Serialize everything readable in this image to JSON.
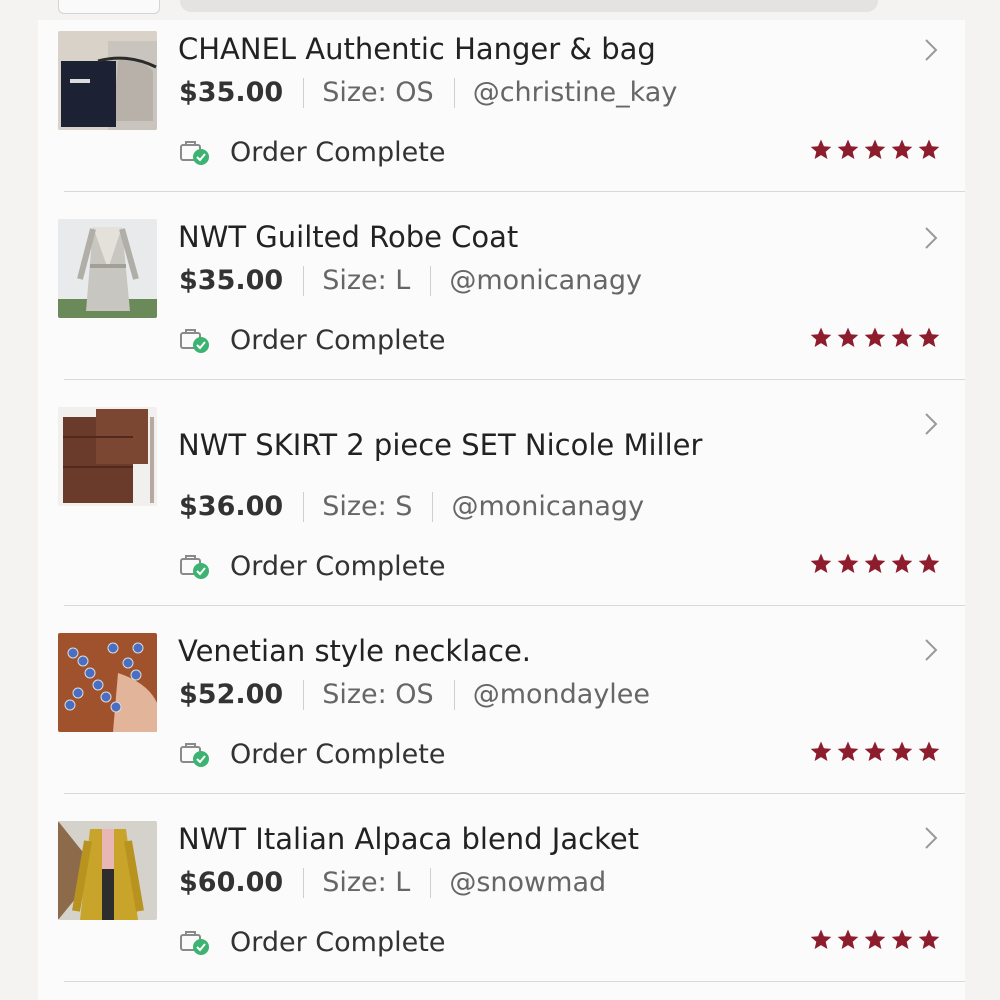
{
  "colors": {
    "star": "#8d1d2d",
    "check": "#3cb371",
    "separator": "#d9d9d9"
  },
  "orders": [
    {
      "title": "CHANEL Authentic Hanger & bag",
      "price": "$35.00",
      "size": "Size: OS",
      "seller": "@christine_kay",
      "status": "Order Complete",
      "rating": 5,
      "thumb_icon": "hanger-bag-photo"
    },
    {
      "title": "NWT Guilted Robe Coat",
      "price": "$35.00",
      "size": "Size: L",
      "seller": "@monicanagy",
      "status": "Order Complete",
      "rating": 5,
      "thumb_icon": "robe-coat-photo"
    },
    {
      "title": "NWT SKIRT 2 piece SET Nicole Miller",
      "price": "$36.00",
      "size": "Size: S",
      "seller": "@monicanagy",
      "status": "Order Complete",
      "rating": 5,
      "thumb_icon": "skirt-set-photo"
    },
    {
      "title": "Venetian style necklace.",
      "price": "$52.00",
      "size": "Size: OS",
      "seller": "@mondaylee",
      "status": "Order Complete",
      "rating": 5,
      "thumb_icon": "necklace-photo"
    },
    {
      "title": "NWT Italian Alpaca blend Jacket",
      "price": "$60.00",
      "size": "Size: L",
      "seller": "@snowmad",
      "status": "Order Complete",
      "rating": 5,
      "thumb_icon": "jacket-photo"
    }
  ]
}
